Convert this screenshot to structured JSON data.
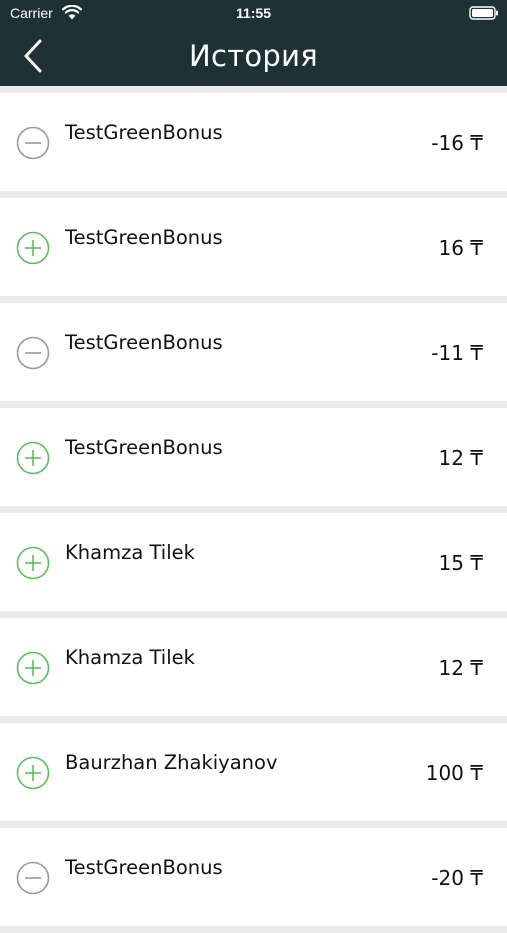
{
  "status_bar": {
    "carrier": "Carrier",
    "time": "11:55",
    "wifi_icon": "wifi-icon",
    "battery_icon": "battery-icon"
  },
  "nav": {
    "title": "История",
    "back_icon": "chevron-left-icon"
  },
  "colors": {
    "header_bg": "#1e3236",
    "credit": "#5cbf5c",
    "debit": "#9a9a9a",
    "separator": "#ebebeb"
  },
  "transactions": [
    {
      "name": "TestGreenBonus",
      "amount": "-16 ₸",
      "type": "debit",
      "icon": "minus-circle-icon"
    },
    {
      "name": "TestGreenBonus",
      "amount": "16 ₸",
      "type": "credit",
      "icon": "plus-circle-icon"
    },
    {
      "name": "TestGreenBonus",
      "amount": "-11 ₸",
      "type": "debit",
      "icon": "minus-circle-icon"
    },
    {
      "name": "TestGreenBonus",
      "amount": "12 ₸",
      "type": "credit",
      "icon": "plus-circle-icon"
    },
    {
      "name": "Khamza Tilek",
      "amount": "15 ₸",
      "type": "credit",
      "icon": "plus-circle-icon"
    },
    {
      "name": "Khamza Tilek",
      "amount": "12 ₸",
      "type": "credit",
      "icon": "plus-circle-icon"
    },
    {
      "name": "Baurzhan Zhakiyanov",
      "amount": "100 ₸",
      "type": "credit",
      "icon": "plus-circle-icon"
    },
    {
      "name": "TestGreenBonus",
      "amount": "-20 ₸",
      "type": "debit",
      "icon": "minus-circle-icon"
    }
  ]
}
